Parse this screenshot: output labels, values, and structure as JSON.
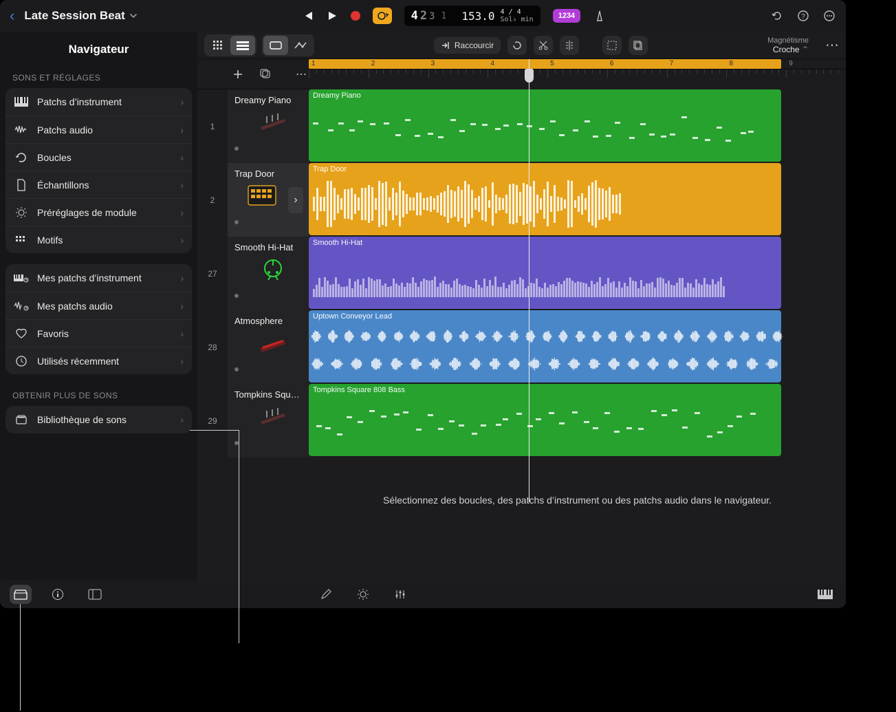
{
  "header": {
    "back_icon": "‹",
    "title": "Late Session Beat",
    "lcd_bar": "4",
    "lcd_beat": "2",
    "lcd_div": "3",
    "lcd_sub": "1",
    "tempo": "153.0",
    "sig_top": "4 / 4",
    "sig_bottom": "Sol♭ min",
    "tuner_label": "1234"
  },
  "sidebar": {
    "title": "Navigateur",
    "section1": "SONS ET RÉGLAGES",
    "items1": [
      {
        "label": "Patchs d’instrument"
      },
      {
        "label": "Patchs audio"
      },
      {
        "label": "Boucles"
      },
      {
        "label": "Échantillons"
      },
      {
        "label": "Préréglages de module"
      },
      {
        "label": "Motifs"
      }
    ],
    "items2": [
      {
        "label": "Mes patchs d’instrument"
      },
      {
        "label": "Mes patchs audio"
      },
      {
        "label": "Favoris"
      },
      {
        "label": "Utilisés récemment"
      }
    ],
    "section3": "OBTENIR PLUS DE SONS",
    "items3": [
      {
        "label": "Bibliothèque de sons"
      }
    ]
  },
  "toolbar": {
    "trim_label": "Raccourcir",
    "snap_title": "Magnétisme",
    "snap_value": "Croche"
  },
  "ruler": {
    "bars": [
      "1",
      "2",
      "3",
      "4",
      "5",
      "6",
      "7",
      "8",
      "9"
    ]
  },
  "tracks": [
    {
      "num": "1",
      "name": "Dreamy Piano",
      "clip": "Dreamy Piano",
      "color": "green",
      "thumb": "keys"
    },
    {
      "num": "2",
      "name": "Trap Door",
      "clip": "Trap Door",
      "color": "yellow",
      "thumb": "drummachine",
      "selected": true
    },
    {
      "num": "27",
      "name": "Smooth Hi-Hat",
      "clip": "Smooth Hi-Hat",
      "color": "purple",
      "thumb": "session"
    },
    {
      "num": "28",
      "name": "Atmosphere",
      "clip": "Uptown Conveyor Lead",
      "color": "blue",
      "thumb": "synth"
    },
    {
      "num": "29",
      "name": "Tompkins Squ…",
      "clip": "Tompkins Square 808 Bass",
      "color": "green2",
      "thumb": "keys"
    }
  ],
  "hint": "Sélectionnez des boucles, des patchs d’instrument ou des patchs audio dans le navigateur."
}
